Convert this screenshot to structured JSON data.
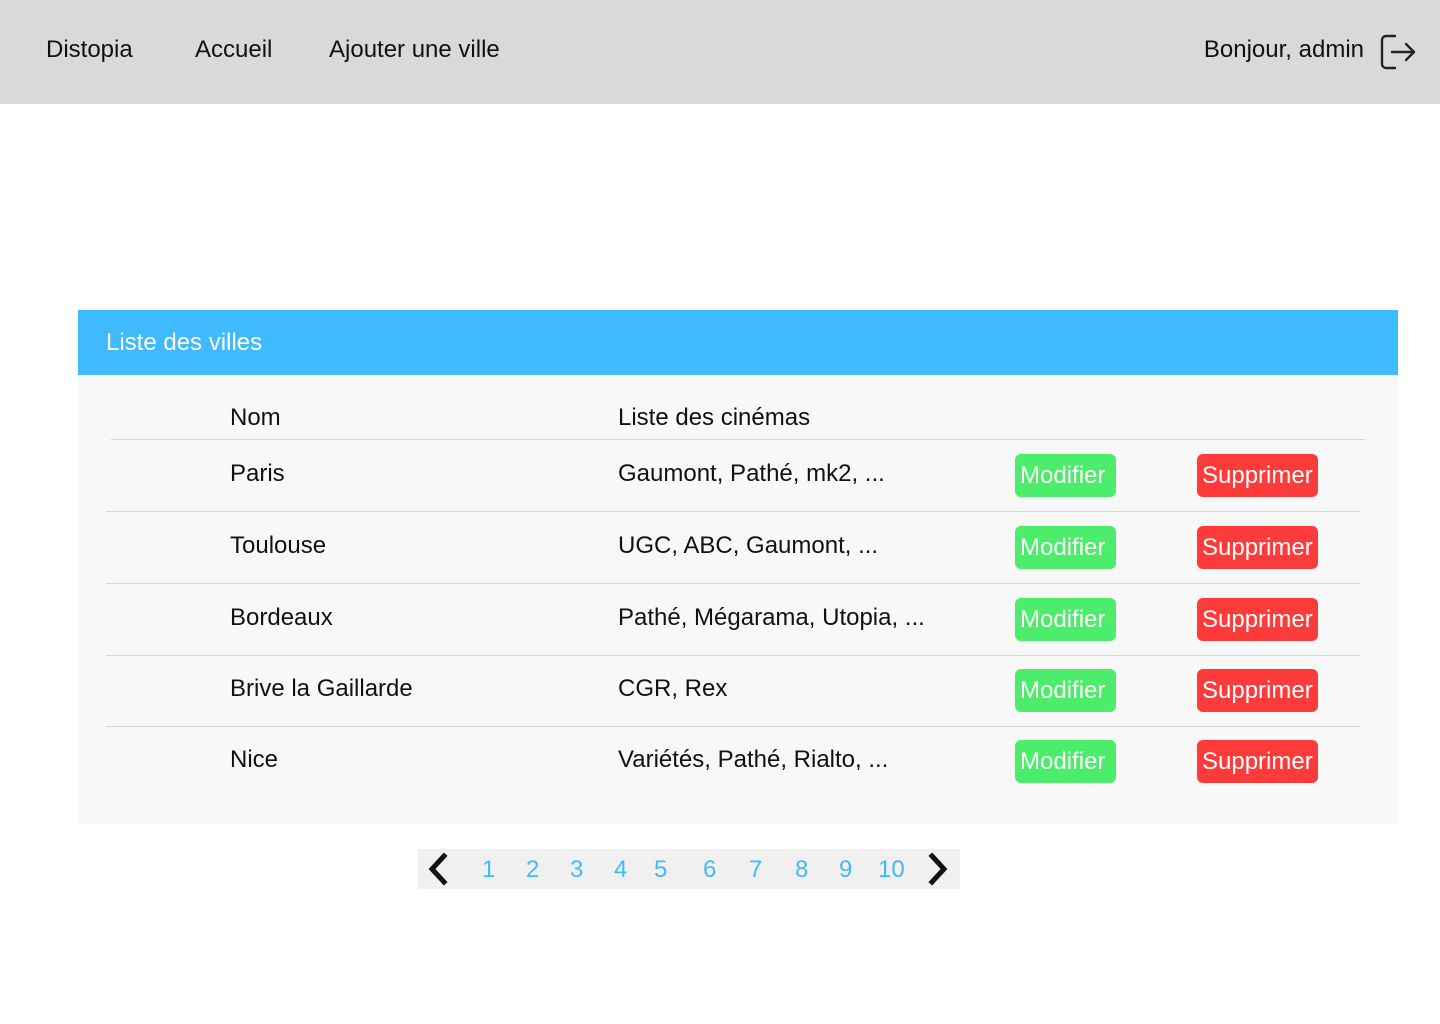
{
  "nav": {
    "brand": "Distopia",
    "home": "Accueil",
    "add_city": "Ajouter une ville",
    "greeting": "Bonjour, admin",
    "logout_icon": "logout-icon"
  },
  "panel": {
    "title": "Liste des villes",
    "columns": {
      "name": "Nom",
      "cinemas": "Liste des cinémas"
    },
    "rows": [
      {
        "name": "Paris",
        "cinemas": "Gaumont, Pathé, mk2, ...",
        "edit": "Modifier",
        "delete": "Supprimer"
      },
      {
        "name": "Toulouse",
        "cinemas": "UGC, ABC, Gaumont, ...",
        "edit": "Modifier",
        "delete": "Supprimer"
      },
      {
        "name": "Bordeaux",
        "cinemas": "Pathé, Mégarama, Utopia, ...",
        "edit": "Modifier",
        "delete": "Supprimer"
      },
      {
        "name": "Brive la Gaillarde",
        "cinemas": "CGR, Rex",
        "edit": "Modifier",
        "delete": "Supprimer"
      },
      {
        "name": "Nice",
        "cinemas": "Variétés, Pathé, Rialto, ...",
        "edit": "Modifier",
        "delete": "Supprimer"
      }
    ]
  },
  "pagination": {
    "prev_icon": "chevron-left-icon",
    "next_icon": "chevron-right-icon",
    "pages": [
      "1",
      "2",
      "3",
      "4",
      "5",
      "6",
      "7",
      "8",
      "9",
      "10"
    ]
  },
  "colors": {
    "topbar": "#d9d9d9",
    "accent": "#3fbafd",
    "edit_button": "#4bed6a",
    "delete_button": "#fd3b3b",
    "panel_background": "#f8f8f8"
  }
}
